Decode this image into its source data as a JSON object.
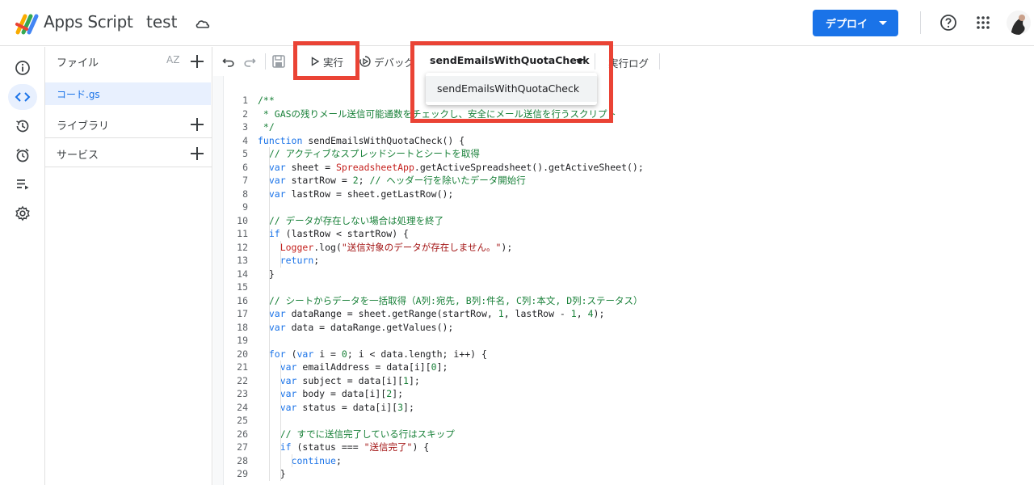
{
  "header": {
    "app_name": "Apps Script",
    "project_name": "test",
    "deploy_label": "デプロイ"
  },
  "files_panel": {
    "title": "ファイル",
    "sort_label": "AZ",
    "file_name": "コード.gs",
    "sections": [
      "ライブラリ",
      "サービス"
    ]
  },
  "toolbar": {
    "run_label": "実行",
    "debug_label": "デバッグ",
    "function_selected": "sendEmailsWithQuotaCheck",
    "log_label": "実行ログ"
  },
  "dropdown": {
    "options": [
      "sendEmailsWithQuotaCheck"
    ]
  },
  "code": {
    "line_numbers": [
      "1",
      "2",
      "3",
      "4",
      "5",
      "6",
      "7",
      "8",
      "9",
      "10",
      "11",
      "12",
      "13",
      "14",
      "15",
      "16",
      "17",
      "18",
      "19",
      "20",
      "21",
      "22",
      "23",
      "24",
      "25",
      "26",
      "27",
      "28",
      "29"
    ],
    "lines": [
      "/**",
      " * GASの残りメール送信可能通数をチェックし、安全にメール送信を行うスクリプト",
      " */",
      "function sendEmailsWithQuotaCheck() {",
      "  // アクティブなスプレッドシートとシートを取得",
      "  var sheet = SpreadsheetApp.getActiveSpreadsheet().getActiveSheet();",
      "  var startRow = 2; // ヘッダー行を除いたデータ開始行",
      "  var lastRow = sheet.getLastRow();",
      "",
      "  // データが存在しない場合は処理を終了",
      "  if (lastRow < startRow) {",
      "    Logger.log(\"送信対象のデータが存在しません。\");",
      "    return;",
      "  }",
      "",
      "  // シートからデータを一括取得（A列:宛先, B列:件名, C列:本文, D列:ステータス）",
      "  var dataRange = sheet.getRange(startRow, 1, lastRow - 1, 4);",
      "  var data = dataRange.getValues();",
      "",
      "  for (var i = 0; i < data.length; i++) {",
      "    var emailAddress = data[i][0];",
      "    var subject = data[i][1];",
      "    var body = data[i][2];",
      "    var status = data[i][3];",
      "",
      "    // すでに送信完了している行はスキップ",
      "    if (status === \"送信完了\") {",
      "      continue;",
      "    }"
    ]
  },
  "colors": {
    "accent": "#1a73e8",
    "highlight": "#ea4335",
    "comment": "#188038",
    "string": "#a31515"
  }
}
